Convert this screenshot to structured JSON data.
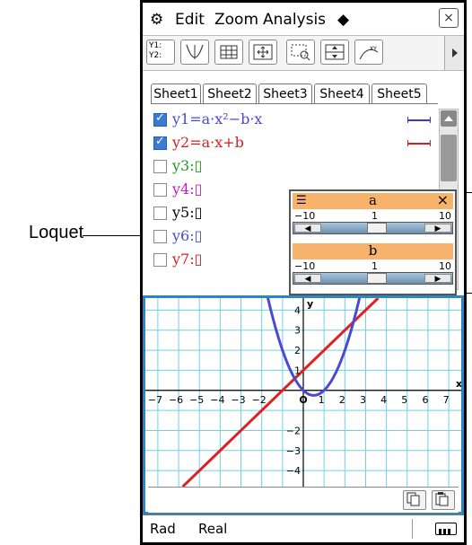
{
  "callout": {
    "label": "Loquet"
  },
  "menubar": {
    "gear_icon": "gear-icon",
    "items": [
      "Edit",
      "Zoom",
      "Analysis"
    ],
    "diamond": "◆",
    "close": "×"
  },
  "toolbar": {
    "first_label_top": "Y1:",
    "first_label_bottom": "Y2:"
  },
  "tabs": [
    "Sheet1",
    "Sheet2",
    "Sheet3",
    "Sheet4",
    "Sheet5"
  ],
  "equations": [
    {
      "label": "y1=a·x²−b·x",
      "checked": true,
      "color": "#4a4ad0",
      "style_color": "#3a3ac8"
    },
    {
      "label": "y2=a·x+b",
      "checked": true,
      "color": "#d42020",
      "style_color": "#d42020"
    },
    {
      "label": "y3:▯",
      "checked": false,
      "color": "#1a9a1a"
    },
    {
      "label": "y4:▯",
      "checked": false,
      "color": "#c020c0"
    },
    {
      "label": "y5:▯",
      "checked": false,
      "color": "#000000"
    },
    {
      "label": "y6:▯",
      "checked": false,
      "color": "#4a4ad0"
    },
    {
      "label": "y7:▯",
      "checked": false,
      "color": "#d42020"
    }
  ],
  "sliders": [
    {
      "name": "a",
      "min": "−10",
      "value": "1",
      "max": "10",
      "level": 0.55
    },
    {
      "name": "b",
      "min": "−10",
      "value": "1",
      "max": "10",
      "level": 0.55
    }
  ],
  "graph": {
    "x_ticks": [
      "−7",
      "−6",
      "−5",
      "−4",
      "−3",
      "−2",
      "0",
      "1",
      "2",
      "3",
      "4",
      "5",
      "6",
      "7"
    ],
    "y_ticks": [
      "4",
      "3",
      "2",
      "1",
      "−2",
      "−3",
      "−4"
    ],
    "x_label": "x",
    "y_label": "y",
    "origin_label": "O",
    "x_range": [
      -7.6,
      7.6
    ],
    "y_range": [
      -4.8,
      4.6
    ],
    "a": 1,
    "b": 1,
    "y1_color": "#4a4ad0",
    "y2_color": "#e02020"
  },
  "statusbar": {
    "angle": "Rad",
    "mode": "Real"
  }
}
